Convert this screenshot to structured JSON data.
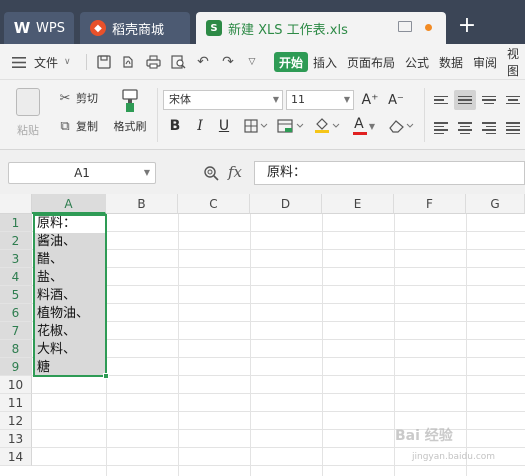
{
  "tabs": {
    "wps": {
      "label": "WPS",
      "icon": "wps-logo-icon"
    },
    "store": {
      "label": "稻壳商城",
      "icon": "docer-store-icon"
    },
    "doc": {
      "label": "新建 XLS 工作表.xls",
      "icon": "spreadsheet-icon",
      "accent": "#2d8a46",
      "unsaved_color": "#f28b24"
    },
    "new_tab": "+"
  },
  "menu": {
    "file_label": "文件",
    "tabs": [
      "开始",
      "插入",
      "页面布局",
      "公式",
      "数据",
      "审阅",
      "视图"
    ],
    "active_tab": "开始",
    "active_color": "#2e9b55"
  },
  "ribbon": {
    "paste_label": "粘贴",
    "cut_label": "剪切",
    "copy_label": "复制",
    "format_painter_label": "格式刷",
    "font_name": "宋体",
    "font_size": "11",
    "bold": "B",
    "italic": "I",
    "underline": "U",
    "font_color_letter": "A",
    "increase_font": "A⁺",
    "decrease_font": "A⁻"
  },
  "formula_bar": {
    "name_box": "A1",
    "fx_label": "fx",
    "content": "原料："
  },
  "grid": {
    "columns": [
      "A",
      "B",
      "C",
      "D",
      "E",
      "F",
      "G"
    ],
    "selected_column": "A",
    "rows": [
      "1",
      "2",
      "3",
      "4",
      "5",
      "6",
      "7",
      "8",
      "9",
      "10",
      "11",
      "12",
      "13",
      "14"
    ],
    "column_a": [
      "原料：",
      "酱油、",
      "醋、",
      "盐、",
      "料酒、",
      "植物油、",
      "花椒、",
      "大料、",
      "糖"
    ],
    "selection_color": "#2e9b55"
  },
  "watermark": {
    "text": "Bai 经验",
    "url_text": "jingyan.baidu.com"
  }
}
